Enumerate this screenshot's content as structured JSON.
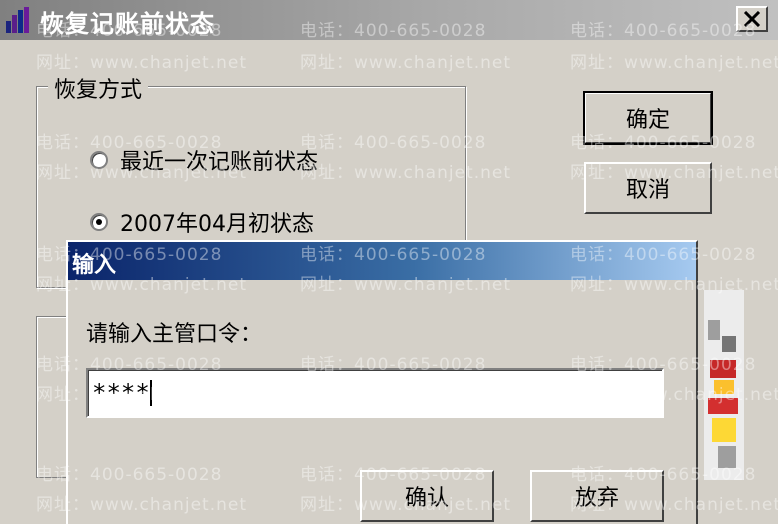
{
  "main_dialog": {
    "title": "恢复记账前状态",
    "group_title": "恢复方式",
    "options": [
      {
        "label": "最近一次记账前状态",
        "checked": false
      },
      {
        "label": "2007年04月初状态",
        "checked": true
      }
    ],
    "ok_button": "确定",
    "cancel_button": "取消"
  },
  "input_dialog": {
    "title": "输入",
    "prompt": "请输入主管口令：",
    "password_value": "****",
    "confirm_button": "确认",
    "abandon_button": "放弃"
  },
  "watermark": {
    "phone": "电话：400-665-0028",
    "site": "网址：www.chanjet.net"
  },
  "icons": {
    "app": "bar-chart-icon",
    "close": "close-icon"
  }
}
